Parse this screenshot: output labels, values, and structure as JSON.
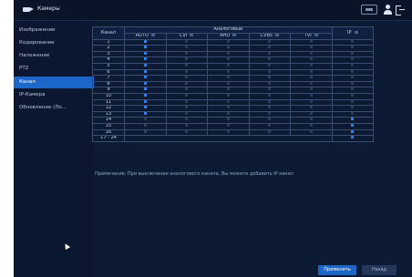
{
  "topbar": {
    "title": "Камеры"
  },
  "sidebar": {
    "items": [
      {
        "label": "Изображение",
        "active": false
      },
      {
        "label": "Кодирование",
        "active": false
      },
      {
        "label": "Наложение",
        "active": false
      },
      {
        "label": "PTZ",
        "active": false
      },
      {
        "label": "Канал",
        "active": true
      },
      {
        "label": "IP-Камера",
        "active": false
      },
      {
        "label": "Обновление (Ло...",
        "active": false
      }
    ]
  },
  "table": {
    "channel_header": "Канал",
    "analog_header": "Аналоговый",
    "ip_header": "IP",
    "columns": [
      "AUTO",
      "CVI",
      "AHD",
      "CVBS",
      "TVI"
    ],
    "rows": [
      {
        "channel": "1",
        "sel": [
          1,
          0,
          0,
          0,
          0
        ],
        "ip": 0
      },
      {
        "channel": "2",
        "sel": [
          1,
          0,
          0,
          0,
          0
        ],
        "ip": 0
      },
      {
        "channel": "3",
        "sel": [
          1,
          0,
          0,
          0,
          0
        ],
        "ip": 0
      },
      {
        "channel": "4",
        "sel": [
          1,
          0,
          0,
          0,
          0
        ],
        "ip": 0
      },
      {
        "channel": "5",
        "sel": [
          1,
          0,
          0,
          0,
          0
        ],
        "ip": 0
      },
      {
        "channel": "6",
        "sel": [
          1,
          0,
          0,
          0,
          0
        ],
        "ip": 0
      },
      {
        "channel": "7",
        "sel": [
          1,
          0,
          0,
          0,
          0
        ],
        "ip": 0
      },
      {
        "channel": "8",
        "sel": [
          1,
          0,
          0,
          0,
          0
        ],
        "ip": 0
      },
      {
        "channel": "9",
        "sel": [
          1,
          0,
          0,
          0,
          0
        ],
        "ip": 0
      },
      {
        "channel": "10",
        "sel": [
          1,
          0,
          0,
          0,
          0
        ],
        "ip": 0
      },
      {
        "channel": "11",
        "sel": [
          1,
          0,
          0,
          0,
          0
        ],
        "ip": 0
      },
      {
        "channel": "12",
        "sel": [
          1,
          0,
          0,
          0,
          0
        ],
        "ip": 0
      },
      {
        "channel": "13",
        "sel": [
          1,
          0,
          0,
          0,
          0
        ],
        "ip": 0
      },
      {
        "channel": "14",
        "sel": [
          0,
          0,
          0,
          0,
          0
        ],
        "ip": 1
      },
      {
        "channel": "15",
        "sel": [
          0,
          0,
          0,
          0,
          0
        ],
        "ip": 1
      },
      {
        "channel": "16",
        "sel": [
          0,
          0,
          0,
          0,
          0
        ],
        "ip": 1
      },
      {
        "channel": "17 - 24",
        "sel": null,
        "ip": 1
      }
    ]
  },
  "note": "Примечание: При выключении аналогового канала, Вы можете добавить IP канал",
  "buttons": {
    "apply": "Применить",
    "back": "Назад"
  },
  "colors": {
    "accent": "#1d67c9",
    "background": "#0d1a33",
    "checked": "#2f7fe0"
  }
}
